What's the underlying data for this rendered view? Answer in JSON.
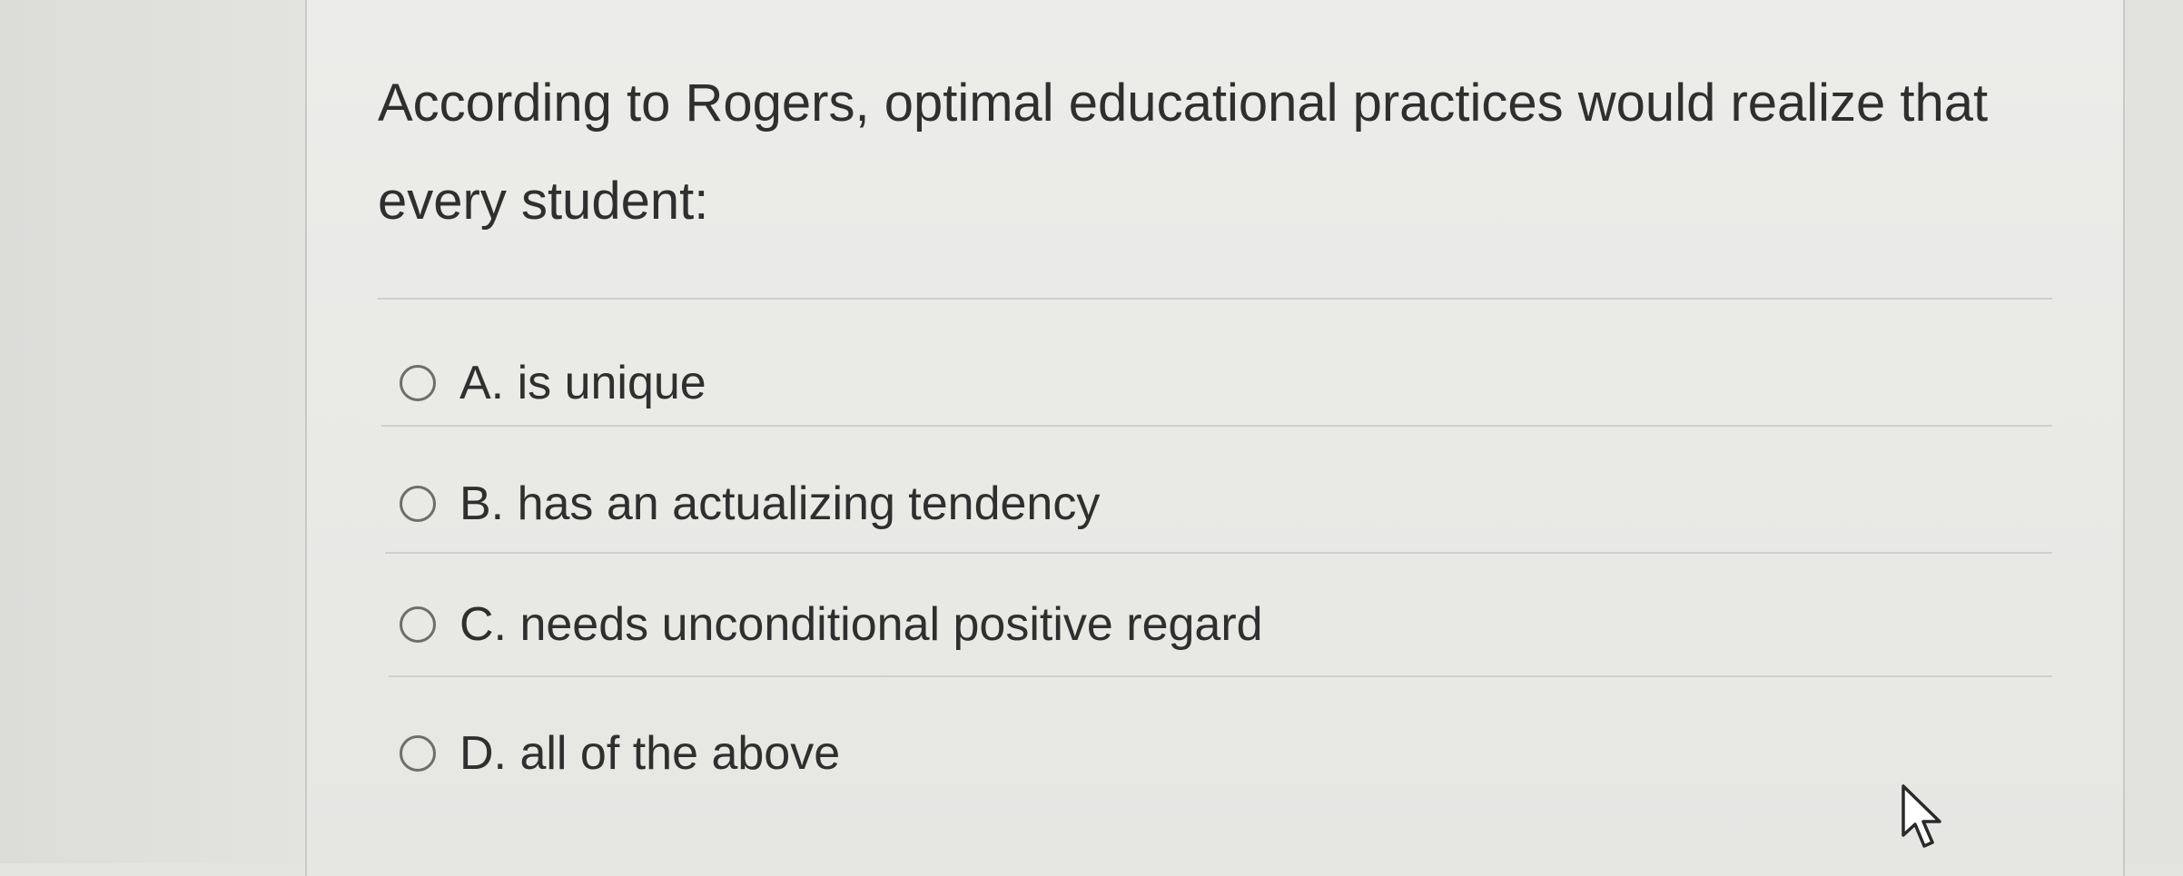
{
  "question": {
    "text": "According to Rogers, optimal educational practices would realize that every student:"
  },
  "options": [
    {
      "label": "A. is unique",
      "selected": false
    },
    {
      "label": "B. has an actualizing tendency",
      "selected": false
    },
    {
      "label": "C. needs unconditional positive regard",
      "selected": false
    },
    {
      "label": "D. all of the above",
      "selected": false
    }
  ],
  "icons": {
    "radio": "radio-button-icon",
    "cursor": "mouse-pointer-icon"
  },
  "colors": {
    "background": "#e4e4e1",
    "card": "#ececea",
    "text": "#2f2f2f",
    "divider": "#cfcfcb",
    "radio_border": "#6d6d6d"
  }
}
